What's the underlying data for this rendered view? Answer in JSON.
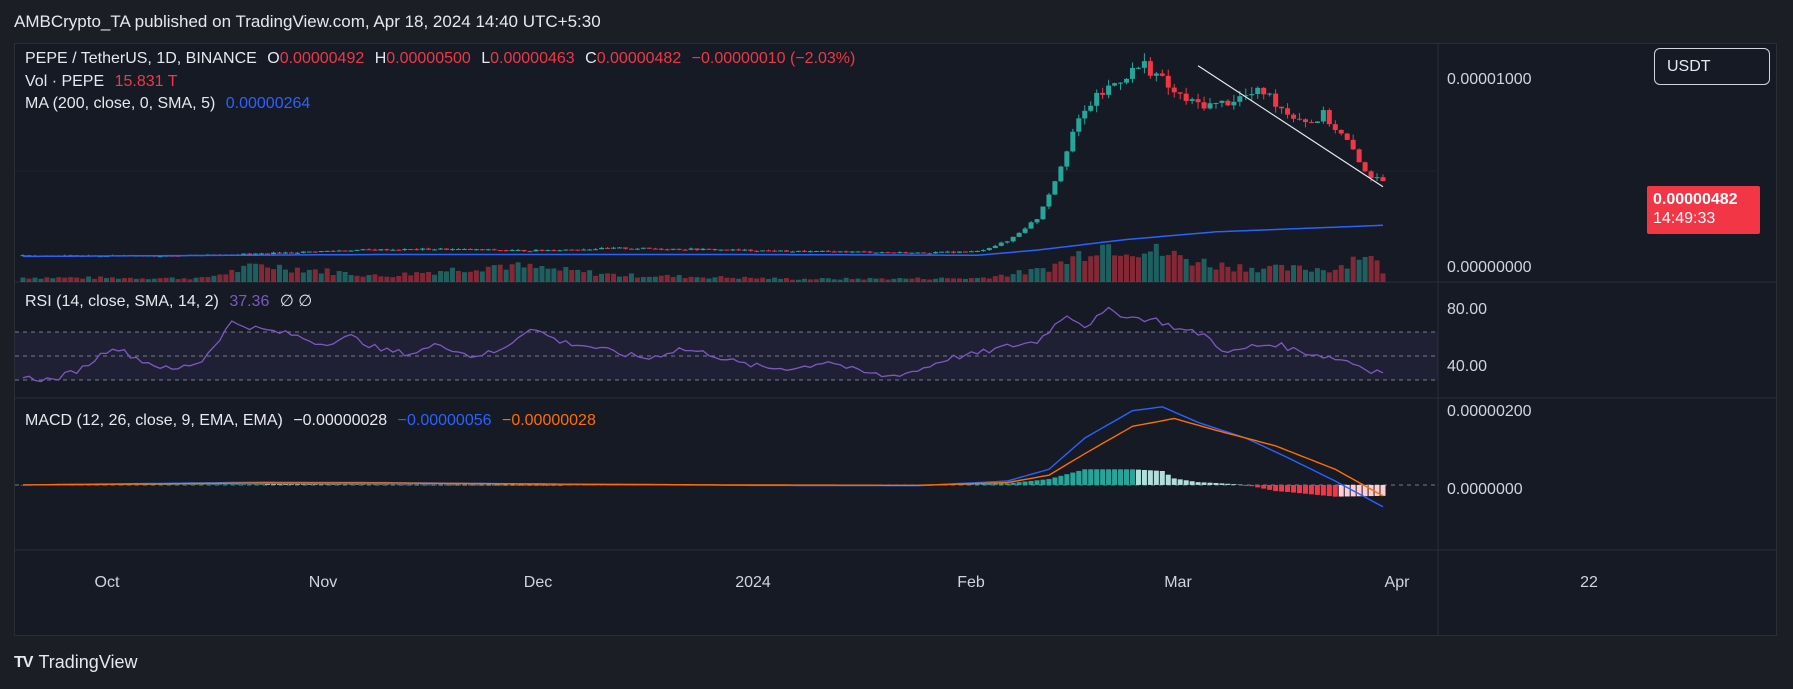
{
  "header": {
    "published": "AMBCrypto_TA published on TradingView.com, Apr 18, 2024 14:40 UTC+5:30"
  },
  "legend": {
    "symbol": "PEPE / TetherUS, 1D, BINANCE",
    "o_label": "O",
    "o": "0.00000492",
    "h_label": "H",
    "h": "0.00000500",
    "l_label": "L",
    "l": "0.00000463",
    "c_label": "C",
    "c": "0.00000482",
    "change": "−0.00000010 (−2.03%)",
    "vol_label": "Vol · PEPE",
    "vol": "15.831 T",
    "ma_label": "MA (200, close, 0, SMA, 5)",
    "ma": "0.00000264",
    "rsi_label": "RSI (14, close, SMA, 14, 2)",
    "rsi": "37.36",
    "rsi_na": "∅ ∅",
    "macd_label": "MACD (12, 26, close, 9, EMA, EMA)",
    "macd_hist": "−0.00000028",
    "macd_line": "−0.00000056",
    "macd_signal": "−0.00000028"
  },
  "currency_button": "USDT",
  "price_tag": {
    "value": "0.00000482",
    "countdown": "14:49:33"
  },
  "brand": {
    "logo": "TV",
    "name": "TradingView"
  },
  "colors": {
    "up": "#26a69a",
    "down": "#f23645",
    "ma": "#2962ff",
    "rsi": "#7e57c2",
    "macd": "#2962ff",
    "signal": "#ff6d00",
    "bg": "#161a25"
  },
  "chart_data": {
    "type": "candlestick",
    "x_tick_labels": [
      "Oct",
      "Nov",
      "Dec",
      "2024",
      "Feb",
      "Mar",
      "Apr",
      "22"
    ],
    "price_axis_labels": [
      "0.00001000",
      "0.00000000"
    ],
    "rsi_axis_labels": [
      "80.00",
      "40.00"
    ],
    "macd_axis_labels": [
      "0.00000200",
      "0.0000000"
    ],
    "price_ylim": [
      0,
      1e-05
    ],
    "rsi_ylim": [
      20,
      95
    ],
    "rsi_bands": [
      70,
      50,
      30
    ],
    "macd_ylim": [
      -1e-06,
      2.2e-06
    ],
    "trendline": {
      "from": [
        1.095e-05,
        "2024-03-16"
      ],
      "to": [
        4.65e-06,
        "2024-04-17"
      ]
    },
    "price_keypoints": [
      [
        0,
        1.07e-06
      ],
      [
        20,
        1.04e-06
      ],
      [
        40,
        1.16e-06
      ],
      [
        55,
        1.35e-06
      ],
      [
        70,
        1.4e-06
      ],
      [
        85,
        1.32e-06
      ],
      [
        100,
        1.45e-06
      ],
      [
        115,
        1.38e-06
      ],
      [
        130,
        1.28e-06
      ],
      [
        140,
        1.26e-06
      ],
      [
        150,
        1.2e-06
      ],
      [
        160,
        1.28e-06
      ],
      [
        165,
        1.8e-06
      ],
      [
        170,
        3e-06
      ],
      [
        173,
        5e-06
      ],
      [
        176,
        7.5e-06
      ],
      [
        179,
        9e-06
      ],
      [
        182,
        9.8e-06
      ],
      [
        185,
        1.05e-05
      ],
      [
        188,
        1.1e-05
      ],
      [
        190,
        1.05e-05
      ],
      [
        193,
        9.5e-06
      ],
      [
        196,
        9e-06
      ],
      [
        200,
        8.9e-06
      ],
      [
        204,
        9.3e-06
      ],
      [
        208,
        9.6e-06
      ],
      [
        212,
        8.5e-06
      ],
      [
        216,
        8e-06
      ],
      [
        218,
        8.4e-06
      ],
      [
        222,
        7e-06
      ],
      [
        224,
        5.9e-06
      ],
      [
        226,
        5.2e-06
      ],
      [
        228,
        4.82e-06
      ]
    ],
    "ma_keypoints": [
      [
        0,
        1.02e-06
      ],
      [
        60,
        1.12e-06
      ],
      [
        120,
        1.12e-06
      ],
      [
        160,
        1.08e-06
      ],
      [
        170,
        1.35e-06
      ],
      [
        185,
        1.9e-06
      ],
      [
        200,
        2.3e-06
      ],
      [
        228,
        2.64e-06
      ]
    ],
    "volume_keypoints": [
      [
        0,
        0.12
      ],
      [
        30,
        0.1
      ],
      [
        40,
        0.45
      ],
      [
        60,
        0.15
      ],
      [
        80,
        0.45
      ],
      [
        100,
        0.18
      ],
      [
        130,
        0.08
      ],
      [
        160,
        0.1
      ],
      [
        170,
        0.3
      ],
      [
        175,
        0.55
      ],
      [
        180,
        1.0
      ],
      [
        185,
        0.95
      ],
      [
        190,
        0.8
      ],
      [
        200,
        0.45
      ],
      [
        210,
        0.35
      ],
      [
        220,
        0.35
      ],
      [
        225,
        0.8
      ],
      [
        228,
        0.3
      ]
    ],
    "rsi_keypoints": [
      [
        0,
        32
      ],
      [
        5,
        30
      ],
      [
        10,
        40
      ],
      [
        15,
        58
      ],
      [
        20,
        46
      ],
      [
        25,
        38
      ],
      [
        30,
        46
      ],
      [
        35,
        78
      ],
      [
        40,
        72
      ],
      [
        45,
        68
      ],
      [
        50,
        60
      ],
      [
        55,
        66
      ],
      [
        60,
        55
      ],
      [
        65,
        52
      ],
      [
        70,
        60
      ],
      [
        75,
        50
      ],
      [
        80,
        54
      ],
      [
        85,
        74
      ],
      [
        90,
        62
      ],
      [
        95,
        58
      ],
      [
        100,
        52
      ],
      [
        105,
        48
      ],
      [
        110,
        56
      ],
      [
        115,
        52
      ],
      [
        120,
        44
      ],
      [
        125,
        40
      ],
      [
        130,
        40
      ],
      [
        135,
        46
      ],
      [
        140,
        37
      ],
      [
        145,
        33
      ],
      [
        150,
        38
      ],
      [
        155,
        48
      ],
      [
        160,
        52
      ],
      [
        165,
        58
      ],
      [
        170,
        62
      ],
      [
        175,
        85
      ],
      [
        178,
        75
      ],
      [
        182,
        88
      ],
      [
        186,
        82
      ],
      [
        190,
        80
      ],
      [
        194,
        72
      ],
      [
        198,
        68
      ],
      [
        202,
        52
      ],
      [
        206,
        58
      ],
      [
        210,
        60
      ],
      [
        214,
        54
      ],
      [
        218,
        50
      ],
      [
        222,
        46
      ],
      [
        226,
        38
      ],
      [
        228,
        37.36
      ]
    ],
    "macd_keypoints": [
      [
        0,
        0
      ],
      [
        40,
        7e-08
      ],
      [
        60,
        6e-08
      ],
      [
        90,
        2e-08
      ],
      [
        120,
        -1e-08
      ],
      [
        150,
        -2e-08
      ],
      [
        165,
        1e-07
      ],
      [
        172,
        4e-07
      ],
      [
        178,
        1.2e-06
      ],
      [
        186,
        1.9e-06
      ],
      [
        191,
        2e-06
      ],
      [
        197,
        1.6e-06
      ],
      [
        205,
        1.2e-06
      ],
      [
        212,
        7e-07
      ],
      [
        220,
        1e-07
      ],
      [
        228,
        -5.6e-07
      ]
    ],
    "signal_keypoints": [
      [
        0,
        0
      ],
      [
        40,
        5e-08
      ],
      [
        60,
        5e-08
      ],
      [
        90,
        2e-08
      ],
      [
        120,
        0
      ],
      [
        150,
        -1e-08
      ],
      [
        165,
        6e-08
      ],
      [
        172,
        2.5e-07
      ],
      [
        178,
        8e-07
      ],
      [
        186,
        1.5e-06
      ],
      [
        193,
        1.7e-06
      ],
      [
        200,
        1.4e-06
      ],
      [
        210,
        1e-06
      ],
      [
        220,
        4e-07
      ],
      [
        228,
        -2.8e-07
      ]
    ]
  }
}
